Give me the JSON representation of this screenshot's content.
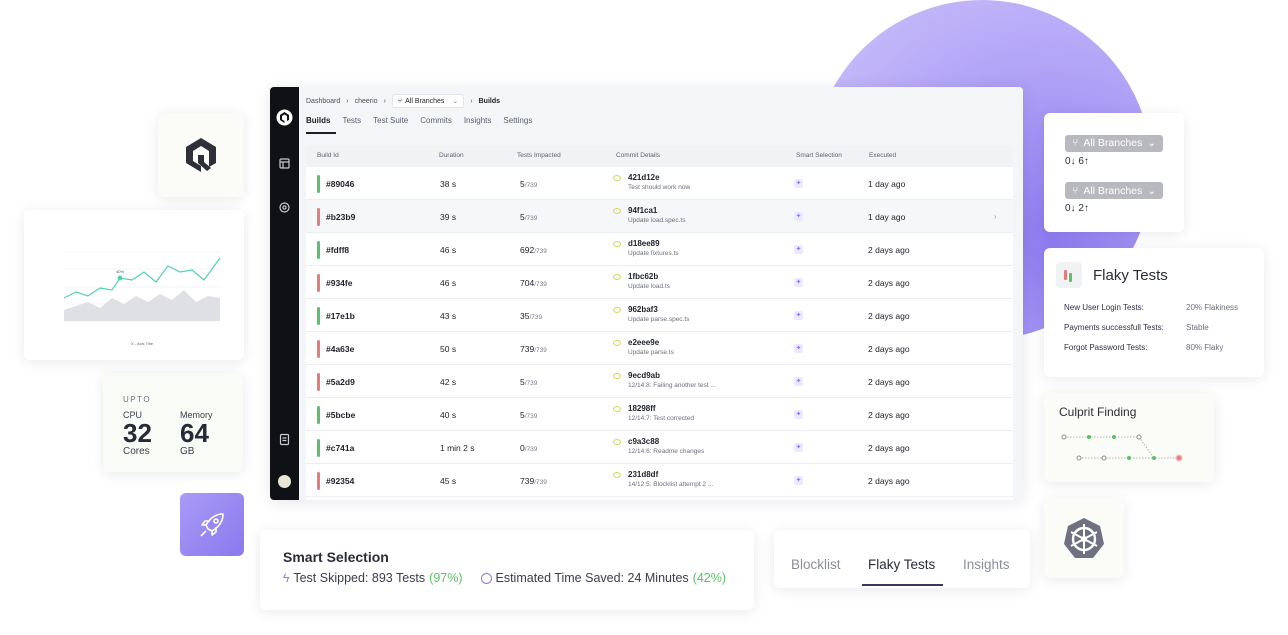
{
  "app": {
    "breadcrumb": {
      "root": "Dashboard",
      "repo": "cheerio",
      "branch": "All Branches",
      "current": "Builds"
    },
    "tabs": [
      "Builds",
      "Tests",
      "Test Suite",
      "Commits",
      "Insights",
      "Settings"
    ],
    "active_tab": "Builds",
    "columns": [
      "Build Id",
      "Duration",
      "Tests Impacted",
      "Commit Details",
      "Smart Selection",
      "Executed"
    ],
    "rows": [
      {
        "id": "#89046",
        "status": "pass",
        "duration": "38 s",
        "impacted": "5",
        "total": "/739",
        "hash": "421d12e",
        "message": "Test should work now",
        "executed": "1 day ago"
      },
      {
        "id": "#b23b9",
        "status": "fail",
        "duration": "39 s",
        "impacted": "5",
        "total": "/739",
        "hash": "94f1ca1",
        "message": "Update load.spec.ts",
        "executed": "1 day ago"
      },
      {
        "id": "#fdff8",
        "status": "pass",
        "duration": "46 s",
        "impacted": "692",
        "total": "/739",
        "hash": "d18ee89",
        "message": "Update fixtures.ts",
        "executed": "2 days ago"
      },
      {
        "id": "#934fe",
        "status": "fail",
        "duration": "46 s",
        "impacted": "704",
        "total": "/739",
        "hash": "1fbc62b",
        "message": "Update load.ts",
        "executed": "2 days ago"
      },
      {
        "id": "#17e1b",
        "status": "pass",
        "duration": "43 s",
        "impacted": "35",
        "total": "/739",
        "hash": "962baf3",
        "message": "Update parse.spec.ts",
        "executed": "2 days ago"
      },
      {
        "id": "#4a63e",
        "status": "fail",
        "duration": "50 s",
        "impacted": "739",
        "total": "/739",
        "hash": "e2eee9e",
        "message": "Update parse.ts",
        "executed": "2 days ago"
      },
      {
        "id": "#5a2d9",
        "status": "fail",
        "duration": "42 s",
        "impacted": "5",
        "total": "/739",
        "hash": "9ecd9ab",
        "message": "12/14:8: Failing another test ...",
        "executed": "2 days ago"
      },
      {
        "id": "#5bcbe",
        "status": "pass",
        "duration": "40 s",
        "impacted": "5",
        "total": "/739",
        "hash": "18298ff",
        "message": "12/14:7: Test corrected",
        "executed": "2 days ago"
      },
      {
        "id": "#c741a",
        "status": "pass",
        "duration": "1 min 2 s",
        "impacted": "0",
        "total": "/739",
        "hash": "c9a3c88",
        "message": "12/14:6: Readme changes",
        "executed": "2 days ago"
      },
      {
        "id": "#92354",
        "status": "fail",
        "duration": "45 s",
        "impacted": "739",
        "total": "/739",
        "hash": "231d8df",
        "message": "14/12:5: Blocklist attempt 2 ...",
        "executed": "2 days ago"
      }
    ]
  },
  "minichart": {
    "annotation": "40%",
    "xlabel": "X - Axis Title"
  },
  "spec": {
    "upto": "UPTO",
    "cpu_label": "CPU",
    "cpu_value": "32",
    "cpu_unit": "Cores",
    "mem_label": "Memory",
    "mem_value": "64",
    "mem_unit": "GB"
  },
  "branches": [
    {
      "label": "All Branches",
      "counts": "0↓ 6↑"
    },
    {
      "label": "All Branches",
      "counts": "0↓ 2↑"
    }
  ],
  "flaky": {
    "title": "Flaky Tests",
    "rows": [
      {
        "name": "New User Login Tests:",
        "value": "20% Flakiness"
      },
      {
        "name": "Payments successfull Tests:",
        "value": "Stable"
      },
      {
        "name": "Forgot Password Tests:",
        "value": "80% Flaky"
      }
    ]
  },
  "culprit": {
    "title": "Culprit Finding"
  },
  "smart": {
    "title": "Smart Selection",
    "skipped_label": "Test Skipped: 893 Tests",
    "skipped_pct": "(97%)",
    "saved_label": "Estimated Time Saved: 24 Minutes",
    "saved_pct": "(42%)"
  },
  "bottom_tabs": {
    "items": [
      "Blocklist",
      "Flaky Tests",
      "Insights"
    ],
    "active": "Flaky Tests"
  },
  "colors": {
    "pass": "#5cbf6b",
    "fail": "#e57c7c",
    "accent": "#8a78ee"
  }
}
